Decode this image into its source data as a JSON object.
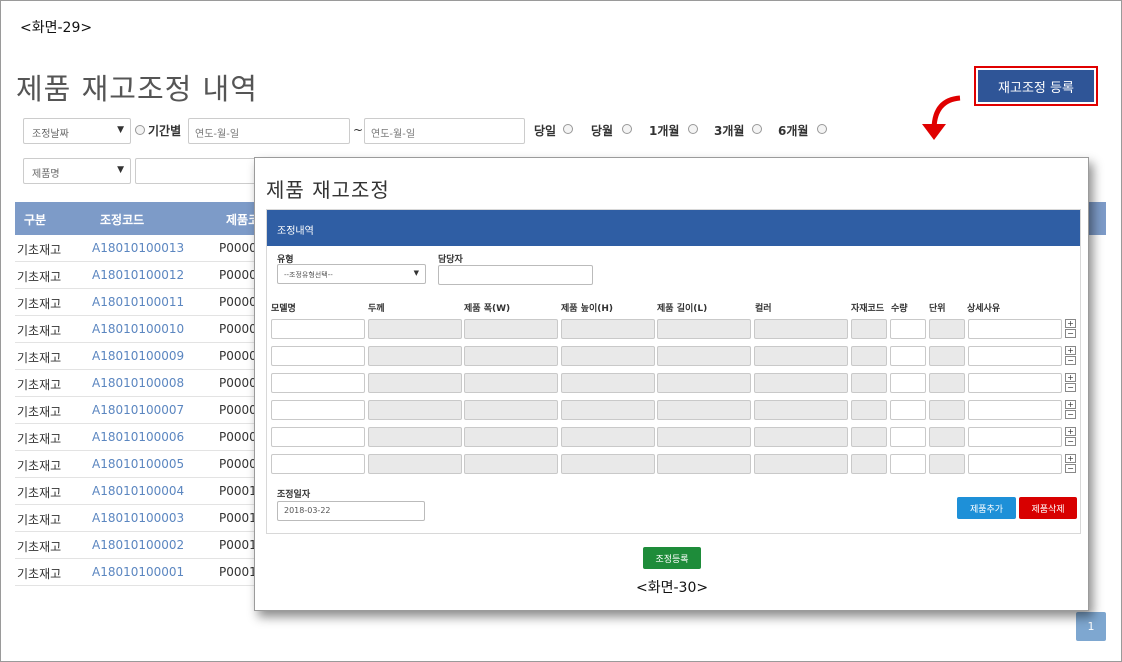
{
  "screen_label_top": "<화면-29>",
  "screen_label_modal": "<화면-30>",
  "page_title": "제품 재고조정 내역",
  "register_button": "재고조정 등록",
  "filters": {
    "date_select": "조정날짜",
    "period_label": "기간별",
    "date_from_placeholder": "연도-월-일",
    "tilde": "~",
    "date_to_placeholder": "연도-월-일",
    "quick_periods": [
      "당일",
      "당월",
      "1개월",
      "3개월",
      "6개월"
    ],
    "product_select": "제품명"
  },
  "table": {
    "columns": [
      "구분",
      "조정코드",
      "제품코"
    ],
    "rows": [
      {
        "type": "기초재고",
        "code": "A18010100013",
        "product": "P0000"
      },
      {
        "type": "기초재고",
        "code": "A18010100012",
        "product": "P0000"
      },
      {
        "type": "기초재고",
        "code": "A18010100011",
        "product": "P0000"
      },
      {
        "type": "기초재고",
        "code": "A18010100010",
        "product": "P0000"
      },
      {
        "type": "기초재고",
        "code": "A18010100009",
        "product": "P0000"
      },
      {
        "type": "기초재고",
        "code": "A18010100008",
        "product": "P0000"
      },
      {
        "type": "기초재고",
        "code": "A18010100007",
        "product": "P0000"
      },
      {
        "type": "기초재고",
        "code": "A18010100006",
        "product": "P0000"
      },
      {
        "type": "기초재고",
        "code": "A18010100005",
        "product": "P0000"
      },
      {
        "type": "기초재고",
        "code": "A18010100004",
        "product": "P0001"
      },
      {
        "type": "기초재고",
        "code": "A18010100003",
        "product": "P0001"
      },
      {
        "type": "기초재고",
        "code": "A18010100002",
        "product": "P0001"
      },
      {
        "type": "기초재고",
        "code": "A18010100001",
        "product": "P0001"
      }
    ]
  },
  "pagination": {
    "current": "1"
  },
  "modal": {
    "title": "제품 재고조정",
    "panel_title": "조정내역",
    "type_label": "유형",
    "type_select": "--조정유형선택--",
    "manager_label": "담당자",
    "manager_value": "",
    "columns": [
      "모델명",
      "두께",
      "제품 폭(W)",
      "제품 높이(H)",
      "제품 길이(L)",
      "컬러",
      "자재코드",
      "수량",
      "단위",
      "상세사유"
    ],
    "row_count": 6,
    "date_label": "조정일자",
    "date_value": "2018-03-22",
    "add_button": "제품추가",
    "delete_button": "제품삭제",
    "submit_button": "조정등록",
    "plus": "+",
    "minus": "−"
  },
  "colors": {
    "primary": "#2f5597",
    "header": "#7d9bc8",
    "highlight": "#e00000",
    "add": "#1e90d8",
    "delete": "#d80000",
    "submit": "#1e8c3a"
  }
}
